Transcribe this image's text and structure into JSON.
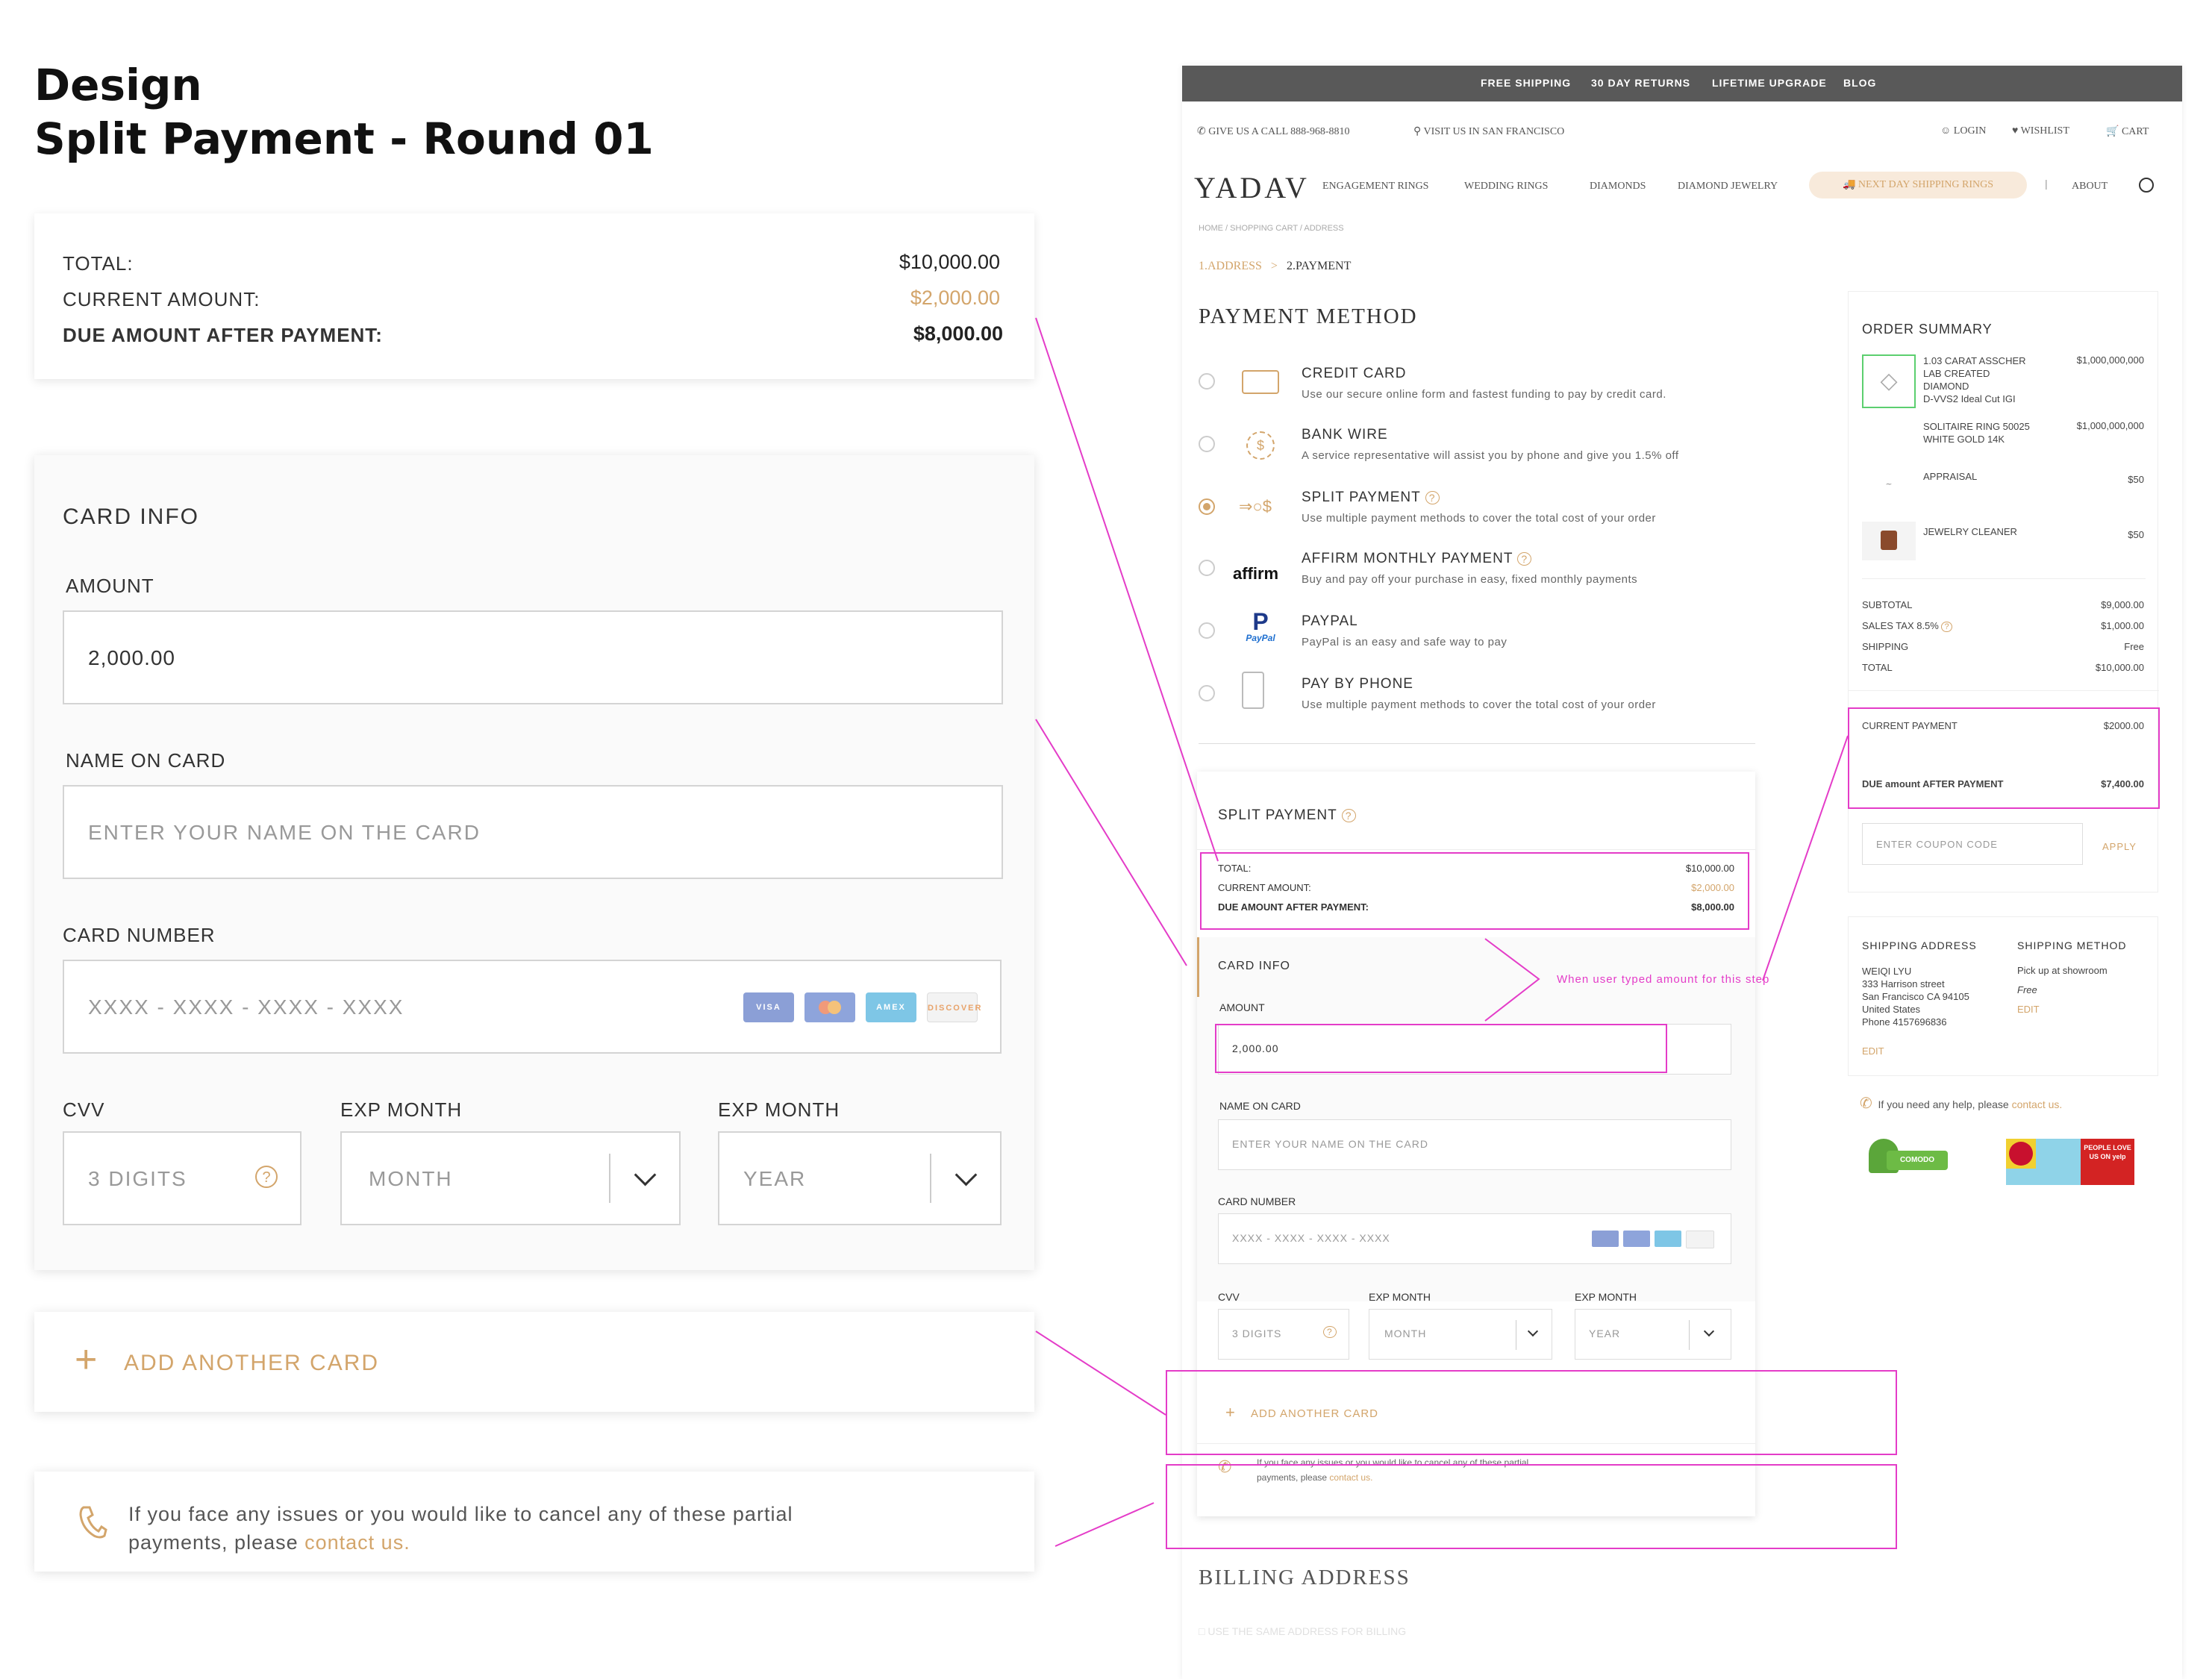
{
  "title": {
    "line1": "Design",
    "line2": "Split Payment - Round 01"
  },
  "summary": {
    "total_label": "TOTAL:",
    "total_value": "$10,000.00",
    "current_label": "CURRENT AMOUNT:",
    "current_value": "$2,000.00",
    "due_label": "DUE AMOUNT AFTER PAYMENT:",
    "due_value": "$8,000.00"
  },
  "card_info": {
    "heading": "CARD INFO",
    "amount_label": "AMOUNT",
    "amount_value": "2,000.00",
    "name_label": "NAME ON CARD",
    "name_placeholder": "ENTER YOUR NAME ON THE CARD",
    "number_label": "CARD NUMBER",
    "number_placeholder": "XXXX - XXXX - XXXX - XXXX",
    "cvv_label": "CVV",
    "cvv_placeholder": "3 DIGITS",
    "exp_month_label": "EXP MONTH",
    "exp_month_value": "MONTH",
    "exp_year_label": "EXP MONTH",
    "exp_year_value": "YEAR",
    "card_brands": [
      "VISA",
      "MC",
      "AMEX",
      "DISCOVER"
    ]
  },
  "add_card": {
    "label": "ADD ANOTHER CARD"
  },
  "help": {
    "text": "If you face any issues or you would like to cancel any of these partial",
    "text2": "payments, please ",
    "link": "contact us."
  },
  "site": {
    "topbar": [
      "FREE SHIPPING",
      "30 DAY RETURNS",
      "LIFETIME UPGRADE",
      "BLOG"
    ],
    "call": "GIVE US A CALL 888-968-8810",
    "visit": "VISIT US IN SAN FRANCISCO",
    "login": "LOGIN",
    "wishlist": "WISHLIST",
    "cart": "CART",
    "logo": "YADAV",
    "nav": [
      "ENGAGEMENT RINGS",
      "WEDDING RINGS",
      "DIAMONDS",
      "DIAMOND JEWELRY"
    ],
    "nav_highlight": "NEXT DAY SHIPPING RINGS",
    "about": "ABOUT",
    "breadcrumb": "HOME  /  SHOPPING CART / ADDRESS",
    "steps": {
      "step1": "1.ADDRESS",
      "sep": ">",
      "step2": "2.PAYMENT"
    },
    "payment_method_title": "PAYMENT METHOD",
    "methods": [
      {
        "title": "CREDIT CARD",
        "desc": "Use our secure online form and fastest funding to pay by credit card."
      },
      {
        "title": "BANK WIRE",
        "desc": "A service representative will assist you by phone and give you 1.5% off"
      },
      {
        "title": "SPLIT PAYMENT",
        "desc": "Use multiple payment methods to cover the total cost of your order"
      },
      {
        "title": "AFFIRM MONTHLY PAYMENT",
        "desc": "Buy and pay off your purchase in easy, fixed monthly payments"
      },
      {
        "title": "PAYPAL",
        "desc": "PayPal is an easy and safe way to pay"
      },
      {
        "title": "PAY BY PHONE",
        "desc": "Use multiple payment methods to cover the total cost of your order"
      }
    ],
    "affirm_logo": "affirm",
    "paypal_logo": "PayPal",
    "split_heading": "SPLIT PAYMENT",
    "annotation": "When user typed amount for this step",
    "billing_title": "BILLING ADDRESS",
    "billing_same": "USE THE SAME ADDRESS FOR BILLING",
    "order": {
      "title": "ORDER SUMMARY",
      "items": [
        {
          "name1": "1.03 CARAT ASSCHER",
          "name2": "LAB CREATED",
          "name3": "DIAMOND",
          "detail": "D-VVS2 Ideal Cut IGI",
          "price": "$1,000,000,000"
        },
        {
          "name1": "SOLITAIRE RING 50025",
          "name2": "WHITE GOLD 14K",
          "price": "$1,000,000,000"
        },
        {
          "name1": "APPRAISAL",
          "price": "$50"
        },
        {
          "name1": "JEWELRY CLEANER",
          "price": "$50"
        }
      ],
      "subtotal_label": "SUBTOTAL",
      "subtotal": "$9,000.00",
      "tax_label": "SALES TAX 8.5%",
      "tax": "$1,000.00",
      "shipping_label": "SHIPPING",
      "shipping": "Free",
      "total_label": "TOTAL",
      "total": "$10,000.00",
      "current_label": "CURRENT PAYMENT",
      "current": "$2000.00",
      "due_label": "DUE amount AFTER PAYMENT",
      "due": "$7,400.00",
      "coupon_placeholder": "ENTER COUPON CODE",
      "apply": "APPLY"
    },
    "shipping_address": {
      "title": "SHIPPING ADDRESS",
      "lines": [
        "WEIQI LYU",
        "333 Harrison street",
        "San Francisco CA 94105",
        "United States",
        "Phone 4157696836"
      ],
      "edit": "EDIT"
    },
    "shipping_method": {
      "title": "SHIPPING METHOD",
      "line": "Pick up at showroom",
      "free": "Free",
      "edit": "EDIT"
    },
    "help_small": "If you need any help, please ",
    "help_small_link": "contact us.",
    "badge_comodo": "COMODO SECURE",
    "badge_yelp": "PEOPLE LOVE US ON yelp"
  },
  "colors": {
    "accent": "#d3a56b",
    "annotation": "#e43cc8",
    "topbar": "#595959"
  }
}
